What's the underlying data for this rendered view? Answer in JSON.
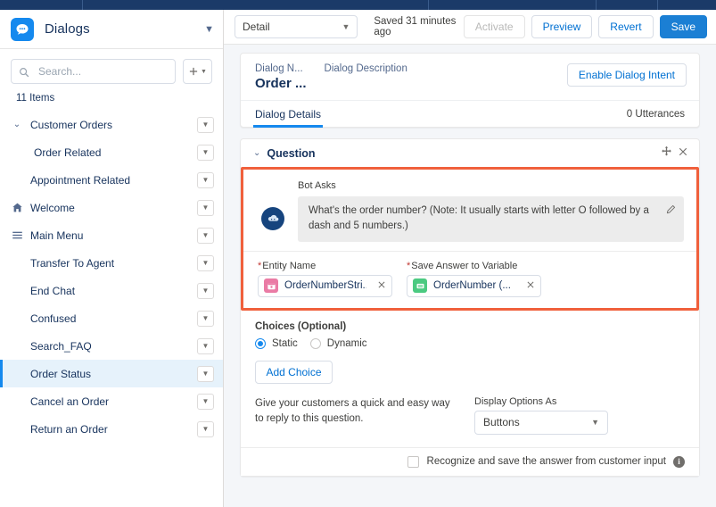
{
  "topnav": {
    "divider_positions": [
      92,
      480,
      668,
      737
    ]
  },
  "sidebar": {
    "app_icon": "chat-bubble-icon",
    "title": "Dialogs",
    "header_caret": "chevron-down-icon",
    "search": {
      "placeholder": "Search...",
      "value": "",
      "icon": "search-icon"
    },
    "new_button": {
      "icon": "plus-icon",
      "caret": "chevron-down-icon"
    },
    "item_count": "11 Items",
    "items": [
      {
        "label": "Customer Orders",
        "twisty": "chevron-down-icon",
        "lead_icon": "",
        "indent": false,
        "selected": false,
        "menu": "chevron-down-icon"
      },
      {
        "label": "Order Related",
        "twisty": "",
        "lead_icon": "",
        "indent": true,
        "selected": false,
        "menu": "chevron-down-icon"
      },
      {
        "label": "Appointment Related",
        "twisty": "",
        "lead_icon": "",
        "indent": false,
        "selected": false,
        "menu": "chevron-down-icon"
      },
      {
        "label": "Welcome",
        "twisty": "",
        "lead_icon": "home-icon",
        "indent": false,
        "selected": false,
        "menu": "chevron-down-icon"
      },
      {
        "label": "Main Menu",
        "twisty": "",
        "lead_icon": "hamburger-icon",
        "indent": false,
        "selected": false,
        "menu": "chevron-down-icon"
      },
      {
        "label": "Transfer To Agent",
        "twisty": "",
        "lead_icon": "",
        "indent": false,
        "selected": false,
        "menu": "chevron-down-icon"
      },
      {
        "label": "End Chat",
        "twisty": "",
        "lead_icon": "",
        "indent": false,
        "selected": false,
        "menu": "chevron-down-icon"
      },
      {
        "label": "Confused",
        "twisty": "",
        "lead_icon": "",
        "indent": false,
        "selected": false,
        "menu": "chevron-down-icon"
      },
      {
        "label": "Search_FAQ",
        "twisty": "",
        "lead_icon": "",
        "indent": false,
        "selected": false,
        "menu": "chevron-down-icon"
      },
      {
        "label": "Order Status",
        "twisty": "",
        "lead_icon": "",
        "indent": false,
        "selected": true,
        "menu": "chevron-down-icon"
      },
      {
        "label": "Cancel an Order",
        "twisty": "",
        "lead_icon": "",
        "indent": false,
        "selected": false,
        "menu": "chevron-down-icon"
      },
      {
        "label": "Return an Order",
        "twisty": "",
        "lead_icon": "",
        "indent": false,
        "selected": false,
        "menu": "chevron-down-icon"
      }
    ]
  },
  "toolbar": {
    "view_select": {
      "value": "Detail",
      "caret": "chevron-down-icon"
    },
    "saved_status": "Saved 31 minutes ago",
    "activate_label": "Activate",
    "preview_label": "Preview",
    "revert_label": "Revert",
    "save_label": "Save"
  },
  "header_card": {
    "name_label": "Dialog N...",
    "name_value": "Order ...",
    "description_label": "Dialog Description",
    "description_value": "",
    "enable_intent_label": "Enable Dialog Intent",
    "tabs": [
      {
        "label": "Dialog Details",
        "active": true
      }
    ],
    "utterances": "0 Utterances"
  },
  "question": {
    "section_title": "Question",
    "collapse_icon": "chevron-down-icon",
    "move_icon": "move-icon",
    "close_icon": "close-icon",
    "bot_asks_label": "Bot Asks",
    "avatar_icon": "bot-avatar-icon",
    "message": "What's the order number? (Note: It usually starts with letter O followed by a dash and 5 numbers.)",
    "edit_icon": "pencil-icon",
    "entity_field": {
      "label": "Entity Name",
      "required": true,
      "icon": "entity-icon",
      "icon_color": "#ea7ba5",
      "value": "OrderNumberStri...",
      "clear_icon": "close-icon"
    },
    "variable_field": {
      "label": "Save Answer to Variable",
      "required": true,
      "icon": "variable-icon",
      "icon_color": "#4bca81",
      "value": "OrderNumber (...",
      "clear_icon": "close-icon"
    },
    "highlight_color": "#f0603c"
  },
  "choices": {
    "label": "Choices (Optional)",
    "options": [
      {
        "label": "Static",
        "selected": true
      },
      {
        "label": "Dynamic",
        "selected": false
      }
    ],
    "add_choice_label": "Add Choice",
    "help_text": "Give your customers a quick and easy way to reply to this question.",
    "display_options_label": "Display Options As",
    "display_options_value": "Buttons",
    "display_options_caret": "chevron-down-icon"
  },
  "recognize": {
    "checked": false,
    "label": "Recognize and save the answer from customer input",
    "info_icon": "info-icon"
  },
  "colors": {
    "brand_blue": "#1589ee",
    "primary_button": "#1b7fd4",
    "nav_navy": "#1b3a68",
    "highlight_red": "#f0603c",
    "link_blue": "#0070d2"
  }
}
